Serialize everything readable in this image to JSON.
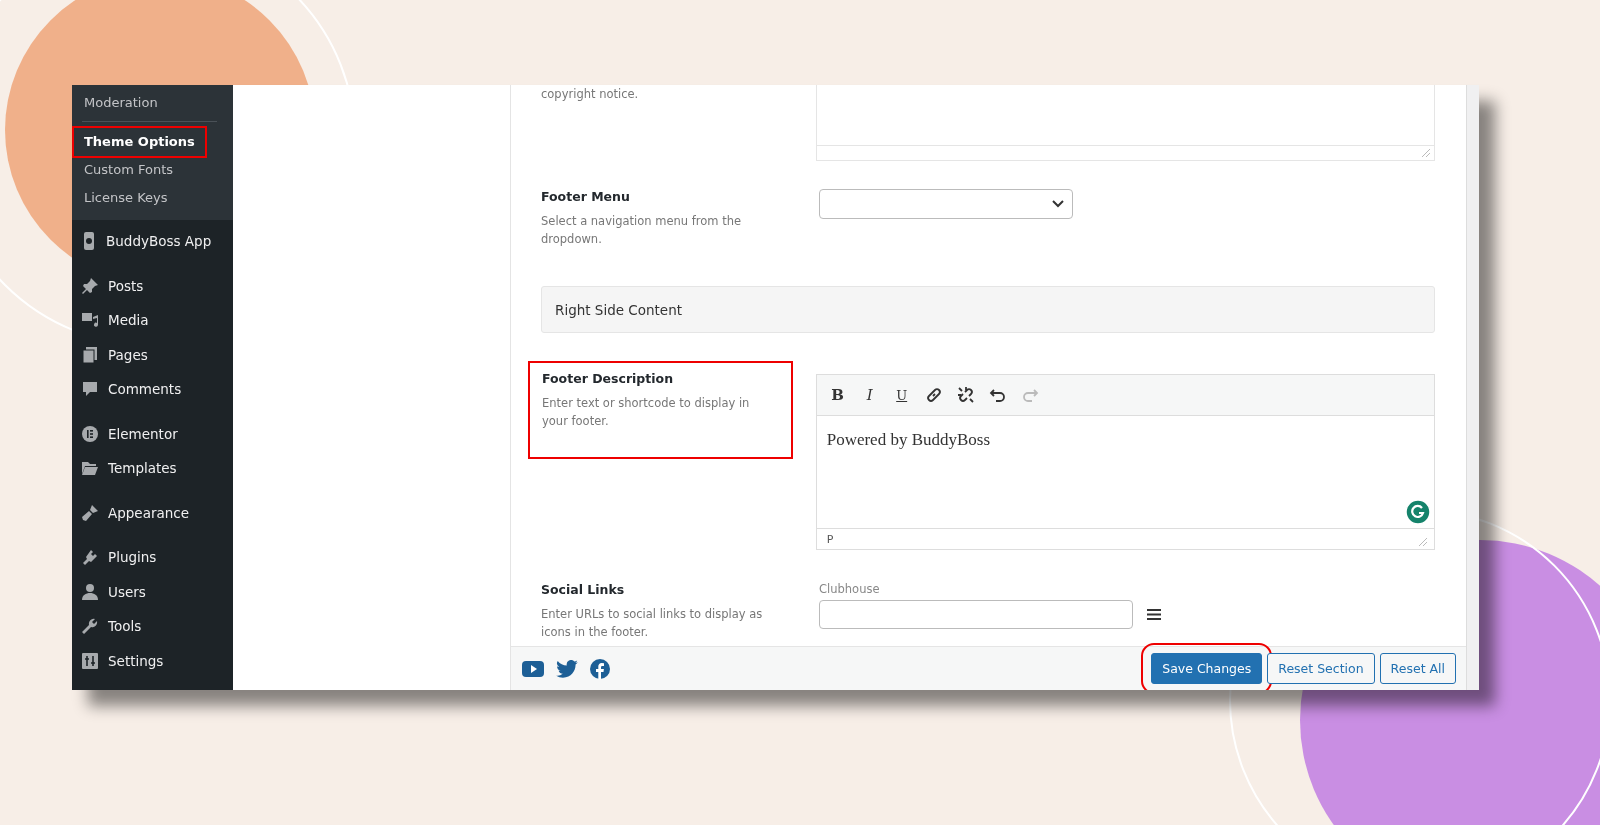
{
  "sidebar": {
    "submenu": [
      {
        "label": "Moderation",
        "selected": false,
        "highlighted": false
      },
      {
        "label": "Theme Options",
        "selected": true,
        "highlighted": true
      },
      {
        "label": "Custom Fonts",
        "selected": false,
        "highlighted": false
      },
      {
        "label": "License Keys",
        "selected": false,
        "highlighted": false
      }
    ],
    "items": [
      {
        "label": "BuddyBoss App"
      },
      {
        "label": "Posts"
      },
      {
        "label": "Media"
      },
      {
        "label": "Pages"
      },
      {
        "label": "Comments"
      },
      {
        "label": "Elementor"
      },
      {
        "label": "Templates"
      },
      {
        "label": "Appearance"
      },
      {
        "label": "Plugins"
      },
      {
        "label": "Users"
      },
      {
        "label": "Tools"
      },
      {
        "label": "Settings"
      }
    ]
  },
  "form": {
    "top_note": "copyright notice.",
    "footer_menu": {
      "label": "Footer Menu",
      "description": "Select a navigation menu from the dropdown."
    },
    "section_heading": "Right Side Content",
    "footer_description": {
      "label": "Footer Description",
      "description": "Enter text or shortcode to display in your footer.",
      "highlighted": true,
      "toolbar": [
        {
          "kind": "bold",
          "label": "B",
          "disabled": false
        },
        {
          "kind": "italic",
          "label": "I",
          "disabled": false
        },
        {
          "kind": "underline",
          "label": "U",
          "disabled": false
        },
        {
          "kind": "link",
          "disabled": false
        },
        {
          "kind": "unlink",
          "disabled": false
        },
        {
          "kind": "undo",
          "disabled": false
        },
        {
          "kind": "redo",
          "disabled": true
        }
      ],
      "content": "Powered by BuddyBoss",
      "path": "P"
    },
    "social_links": {
      "label": "Social Links",
      "description": "Enter URLs to social links to display as icons in the footer.",
      "field_label": "Clubhouse"
    }
  },
  "footer": {
    "buttons": [
      {
        "label": "Save Changes",
        "primary": true,
        "highlighted": true
      },
      {
        "label": "Reset Section",
        "primary": false,
        "highlighted": false
      },
      {
        "label": "Reset All",
        "primary": false,
        "highlighted": false
      }
    ]
  }
}
